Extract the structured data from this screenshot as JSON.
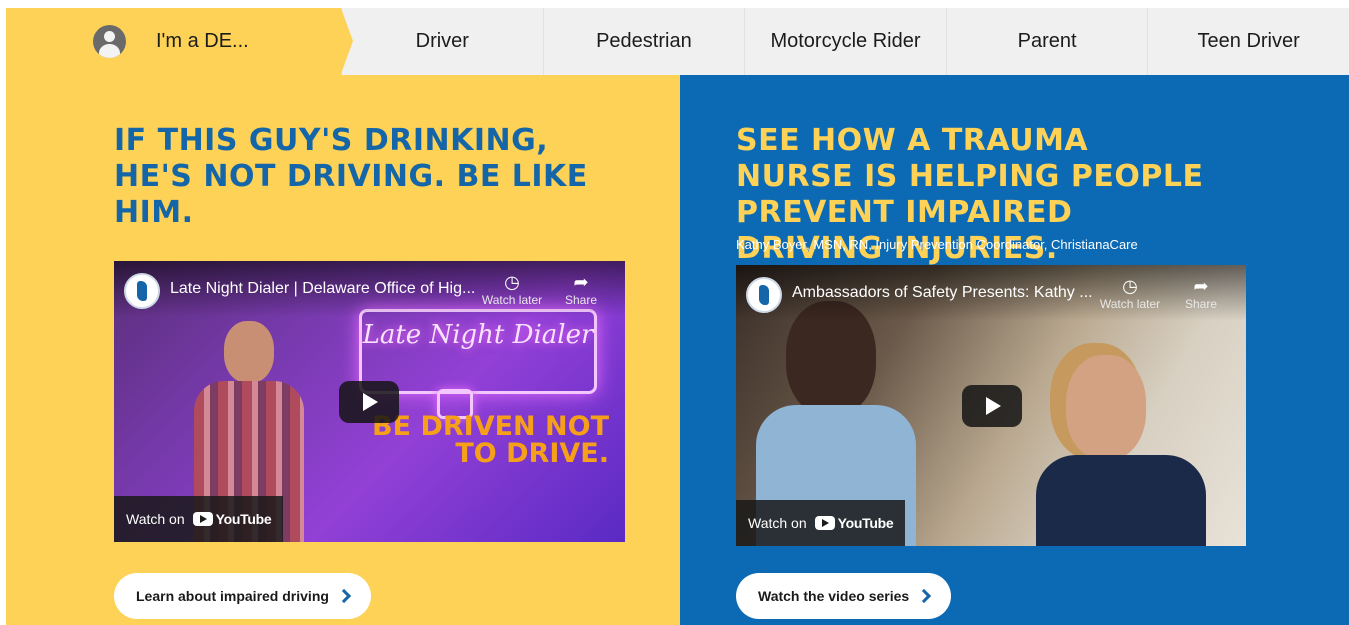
{
  "nav": {
    "items": [
      {
        "label": "I'm a DE...",
        "active": true
      },
      {
        "label": "Driver"
      },
      {
        "label": "Pedestrian"
      },
      {
        "label": "Motorcycle Rider"
      },
      {
        "label": "Parent"
      },
      {
        "label": "Teen Driver"
      }
    ]
  },
  "left": {
    "headline": "If this guy's drinking, he's not driving. Be like him.",
    "video": {
      "title": "Late Night Dialer | Delaware Office of Hig...",
      "watch_later": "Watch later",
      "share": "Share",
      "neon_text": "Late Night Dialer",
      "caption": "BE DRIVEN NOT TO DRIVE.",
      "watch_on": "Watch on",
      "youtube": "YouTube"
    },
    "cta": "Learn about impaired driving"
  },
  "right": {
    "headline": "See how a trauma nurse is helping people prevent impaired driving injuries.",
    "byline": "Kathy Boyer, MSN, RN, Injury Prevention Coordinator, ChristianaCare",
    "video": {
      "title": "Ambassadors of Safety Presents: Kathy ...",
      "watch_later": "Watch later",
      "share": "Share",
      "watch_on": "Watch on",
      "youtube": "YouTube"
    },
    "cta": "Watch the video series"
  },
  "colors": {
    "yellow": "#fdd257",
    "blue": "#0c6ab5",
    "headline_blue": "#1466a8",
    "nav_bg": "#f0f0f0"
  }
}
